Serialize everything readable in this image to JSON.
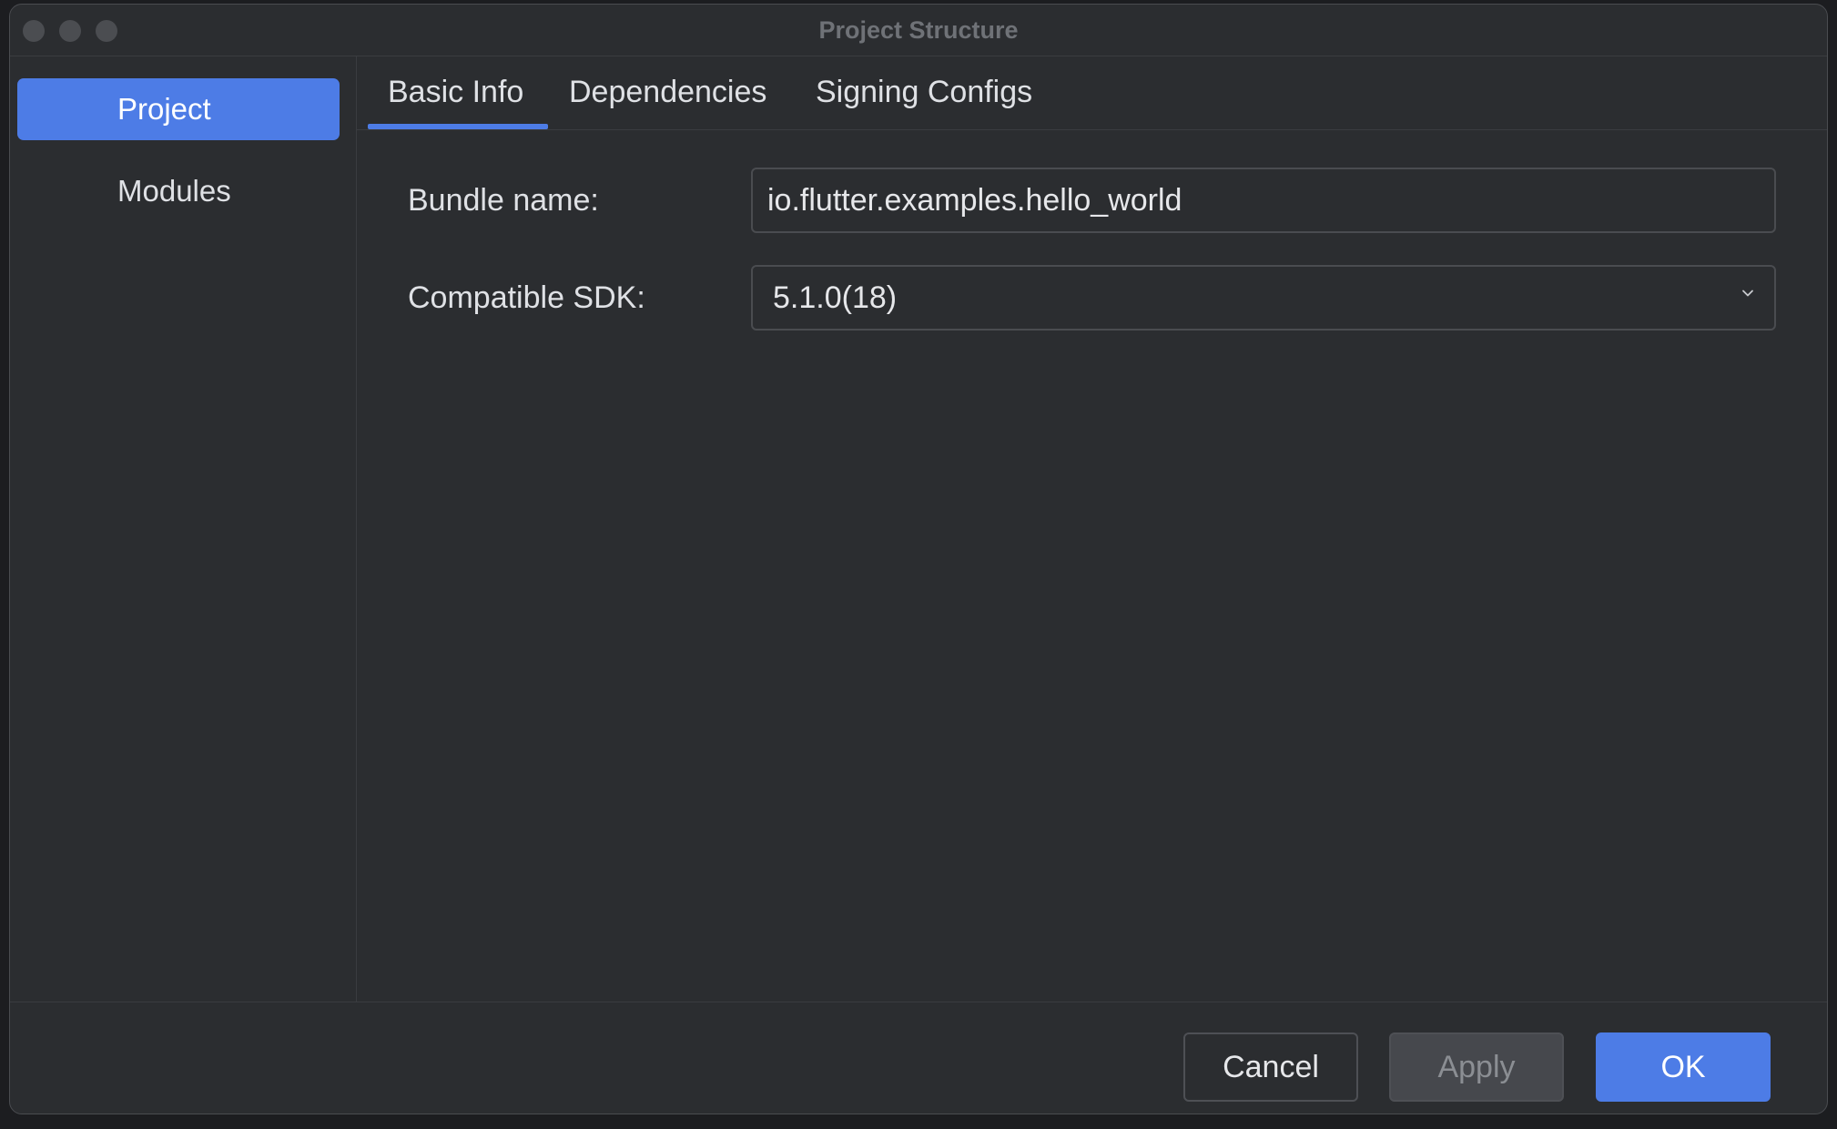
{
  "window": {
    "title": "Project Structure"
  },
  "sidebar": {
    "items": [
      {
        "label": "Project",
        "active": true
      },
      {
        "label": "Modules",
        "active": false
      }
    ]
  },
  "tabs": [
    {
      "label": "Basic Info",
      "active": true
    },
    {
      "label": "Dependencies",
      "active": false
    },
    {
      "label": "Signing Configs",
      "active": false
    }
  ],
  "form": {
    "bundle_name": {
      "label": "Bundle name:",
      "value": "io.flutter.examples.hello_world"
    },
    "compatible_sdk": {
      "label": "Compatible SDK:",
      "selected": "5.1.0(18)",
      "icon": "chevron-down-icon"
    }
  },
  "footer": {
    "cancel_label": "Cancel",
    "apply_label": "Apply",
    "ok_label": "OK"
  },
  "colors": {
    "accent": "#4d7ce6",
    "background": "#2b2d30",
    "text": "#dfe1e5"
  }
}
